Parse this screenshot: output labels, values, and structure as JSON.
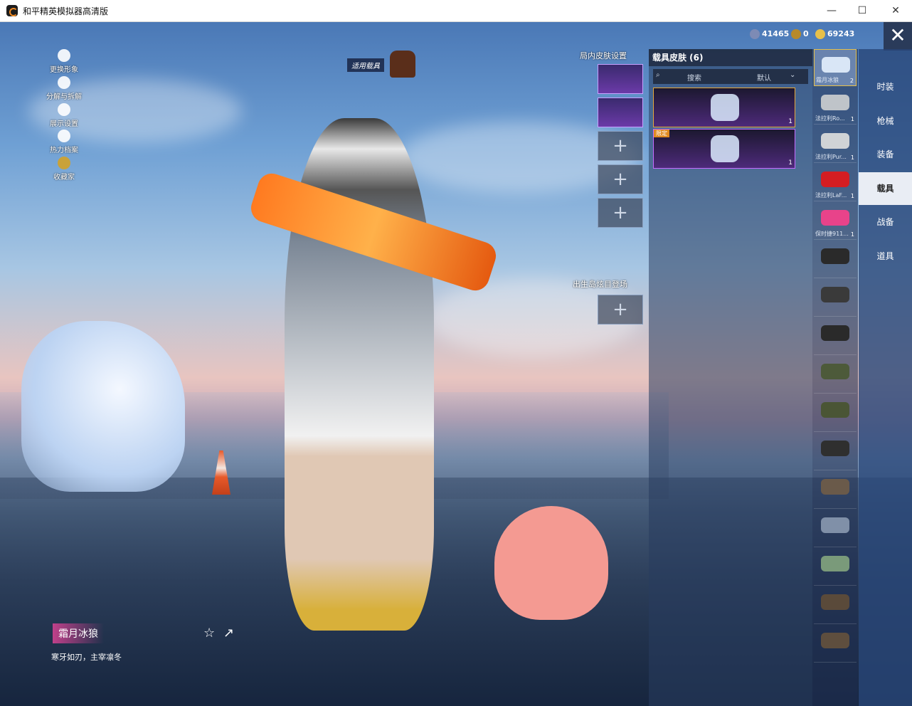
{
  "window": {
    "title": "和平精英模拟器高清版",
    "controls": {
      "minimize": "—",
      "maximize": "☐",
      "close": "✕"
    }
  },
  "hud": {
    "left_menu": [
      {
        "label": "更换形象",
        "icon": "person-icon"
      },
      {
        "label": "分解与拆解",
        "icon": "puzzle-icon"
      },
      {
        "label": "展示设置",
        "icon": "eye-icon"
      },
      {
        "label": "热力档案",
        "icon": "flame-icon"
      },
      {
        "label": "收藏家",
        "icon": "collector-icon"
      }
    ],
    "currencies": [
      {
        "value": "41465",
        "color": "#7d8bb5"
      },
      {
        "value": "0",
        "color": "#b88a2a"
      },
      {
        "value": "69243",
        "color": "#e6c04a"
      }
    ],
    "vehicle_tag": "适用载具"
  },
  "loadout": {
    "ingame_header": "局内皮肤设置",
    "spawn_header": "出生岛炫目登场",
    "plus": "+"
  },
  "skin_panel": {
    "title": "载具皮肤 (6)",
    "search_label": "搜索",
    "sort_label": "默认",
    "cards": [
      {
        "badge": "",
        "count": "1"
      },
      {
        "badge": "限定",
        "count": "1"
      }
    ]
  },
  "vehicles": [
    {
      "name": "霜月冰狼",
      "count": "2"
    },
    {
      "name": "法拉利Ro...",
      "count": "1"
    },
    {
      "name": "法拉利Pur...",
      "count": "1"
    },
    {
      "name": "法拉利LaF...",
      "count": "1"
    },
    {
      "name": "保时捷911...",
      "count": "1"
    },
    {
      "name": "",
      "count": ""
    },
    {
      "name": "",
      "count": ""
    },
    {
      "name": "",
      "count": ""
    },
    {
      "name": "",
      "count": ""
    },
    {
      "name": "",
      "count": ""
    },
    {
      "name": "",
      "count": ""
    },
    {
      "name": "",
      "count": ""
    },
    {
      "name": "",
      "count": ""
    },
    {
      "name": "",
      "count": ""
    },
    {
      "name": "",
      "count": ""
    },
    {
      "name": "",
      "count": ""
    }
  ],
  "categories": [
    "时装",
    "枪械",
    "装备",
    "载具",
    "战备",
    "道具"
  ],
  "active_category": "载具",
  "selected_item": {
    "name": "霜月冰狼",
    "description": "寒牙如刃，主宰凛冬"
  }
}
